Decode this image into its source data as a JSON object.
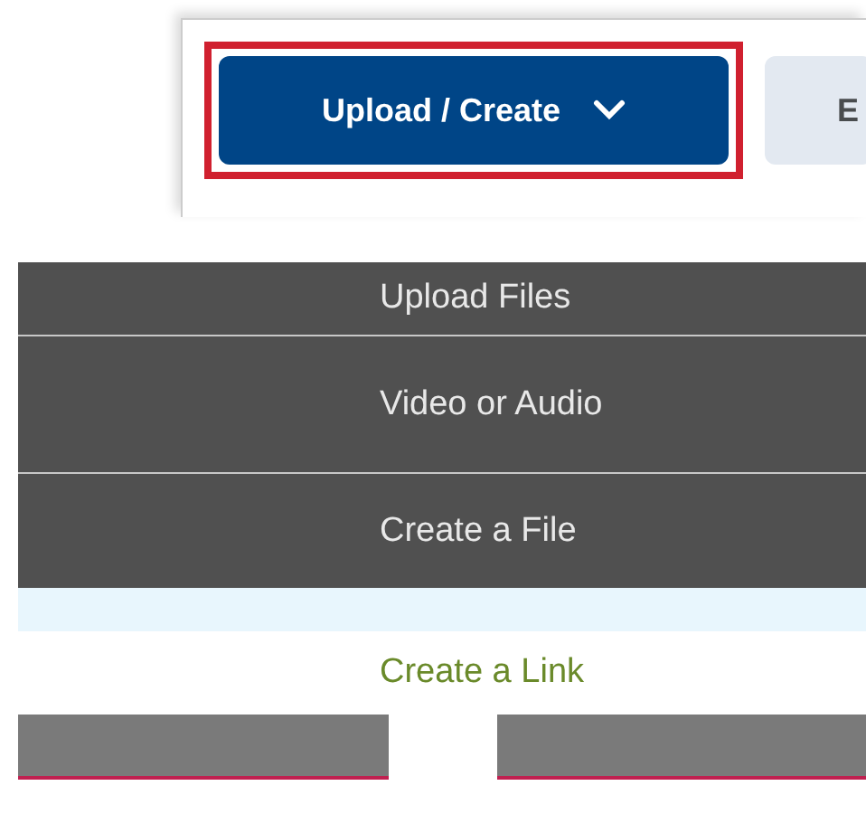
{
  "toolbar": {
    "buttons": [
      {
        "label": "Upload / Create",
        "kind": "primary",
        "highlighted": true
      },
      {
        "label": "E",
        "kind": "secondary",
        "highlighted": false
      }
    ]
  },
  "menu": {
    "items": [
      {
        "label": "Upload Files"
      },
      {
        "label": "Video or Audio"
      },
      {
        "label": "Create a File"
      },
      {
        "label": "Create a Link"
      }
    ]
  }
}
